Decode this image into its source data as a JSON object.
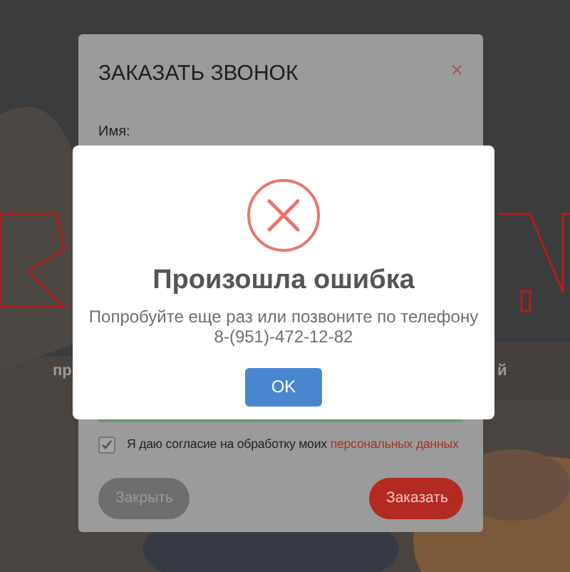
{
  "background": {
    "kind": "picture",
    "hero_text": [
      "пр",
      "й"
    ]
  },
  "order_form": {
    "title": "ЗАКАЗАТЬ ЗВОНОК",
    "close": "×",
    "fields": [
      {
        "label": "Имя:"
      }
    ],
    "consent": {
      "checked": true,
      "text": "Я даю согласие на обработку моих ",
      "link": "персональных данных"
    },
    "buttons": [
      {
        "label": "Закрыть",
        "kind": "secondary"
      },
      {
        "label": "Заказать",
        "kind": "primary"
      }
    ]
  },
  "error_dialog": {
    "title": "Произошла ошибка",
    "message": "Попробуйте еще раз или позвоните по телефону 8-(951)-472-12-82",
    "button": "OK"
  }
}
